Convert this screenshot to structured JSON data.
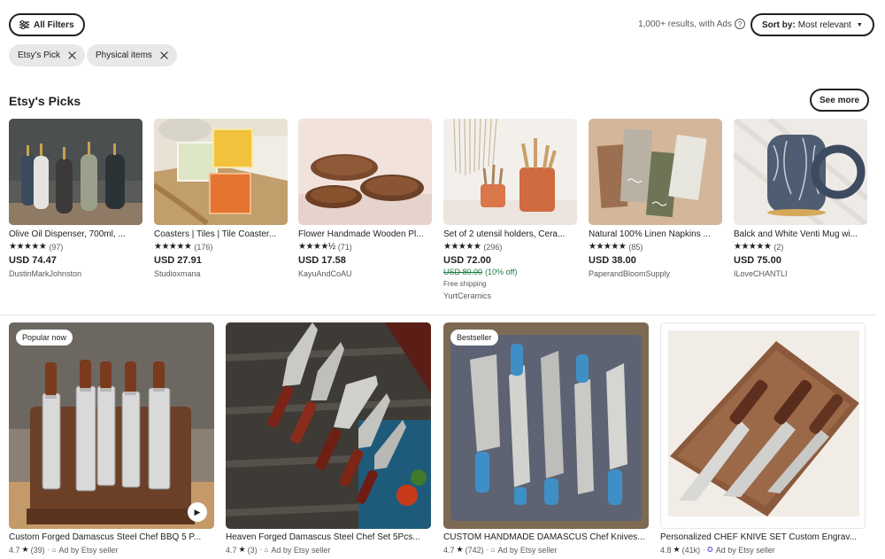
{
  "filters": {
    "all_filters_label": "All Filters",
    "chips": [
      {
        "label": "Etsy's Pick"
      },
      {
        "label": "Physical items"
      }
    ]
  },
  "results": {
    "count_text": "1,000+ results, with Ads",
    "help_glyph": "?",
    "sort_prefix": "Sort by:",
    "sort_value": "Most relevant"
  },
  "picks": {
    "title": "Etsy's Picks",
    "see_more": "See more",
    "items": [
      {
        "title": "Olive Oil Dispenser, 700ml, ...",
        "stars": "★★★★★",
        "reviews": "(97)",
        "price": "USD 74.47",
        "shop": "DustinMarkJohnston"
      },
      {
        "title": "Coasters | Tiles | Tile Coaster...",
        "stars": "★★★★★",
        "reviews": "(176)",
        "price": "USD 27.91",
        "shop": "Studioxmana"
      },
      {
        "title": "Flower Handmade Wooden Pl...",
        "stars": "★★★★½",
        "reviews": "(71)",
        "price": "USD 17.58",
        "shop": "KayuAndCoAU"
      },
      {
        "title": "Set of 2 utensil holders, Cera...",
        "stars": "★★★★★",
        "reviews": "(296)",
        "price": "USD 72.00",
        "original_price": "USD 80.00",
        "discount": "(10% off)",
        "shipping": "Free shipping",
        "shop": "YurtCeramics"
      },
      {
        "title": "Natural 100% Linen Napkins ...",
        "stars": "★★★★★",
        "reviews": "(85)",
        "price": "USD 38.00",
        "shop": "PaperandBloomSupply"
      },
      {
        "title": "Balck and White Venti Mug wi...",
        "stars": "★★★★★",
        "reviews": "(2)",
        "price": "USD 75.00",
        "shop": "ILoveCHANTLI"
      }
    ]
  },
  "listings": [
    {
      "badge": "Popular now",
      "title": "Custom Forged Damascus Steel Chef BBQ 5 P...",
      "rating": "4.7",
      "reviews": "(39)",
      "ad_text": "Ad by Etsy seller",
      "has_video": true
    },
    {
      "badge": "",
      "title": "Heaven Forged Damascus Steel Chef Set 5Pcs...",
      "rating": "4.7",
      "reviews": "(3)",
      "ad_text": "Ad by Etsy seller",
      "has_video": false
    },
    {
      "badge": "Bestseller",
      "title": "CUSTOM HANDMADE DAMASCUS Chef Knives...",
      "rating": "4.7",
      "reviews": "(742)",
      "ad_text": "Ad by Etsy seller",
      "has_video": false
    },
    {
      "badge": "",
      "title": "Personalized CHEF KNIVE SET Custom Engrav...",
      "rating": "4.8",
      "reviews": "(41k)",
      "ad_text": "Ad by Etsy seller",
      "has_video": false,
      "star_seller": true
    }
  ],
  "icons": {
    "filter": "filter-sliders-icon",
    "close": "close-icon",
    "help": "help-circle-icon",
    "caret": "caret-down-icon",
    "star": "star-icon",
    "ad": "ad-tag-icon",
    "play": "play-icon",
    "star_seller": "star-seller-icon"
  }
}
